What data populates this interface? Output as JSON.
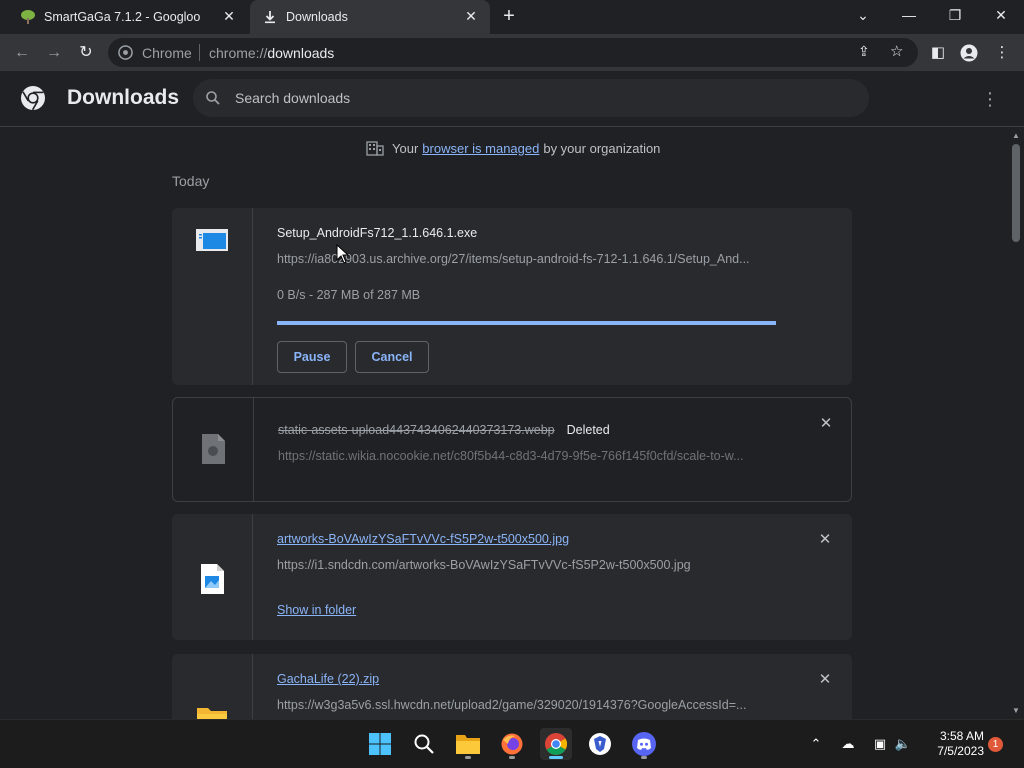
{
  "browser": {
    "tabs": [
      {
        "title": "SmartGaGa 7.1.2 - Googloo",
        "active": false
      },
      {
        "title": "Downloads",
        "active": true
      }
    ],
    "omnibox": {
      "site_label": "Chrome",
      "url_scheme": "chrome://",
      "url_path": "downloads"
    }
  },
  "header": {
    "title": "Downloads",
    "search_placeholder": "Search downloads"
  },
  "managed": {
    "prefix": "Your",
    "link": "browser is managed",
    "suffix": "by your organization"
  },
  "section_label": "Today",
  "downloads": [
    {
      "filename": "Setup_AndroidFs712_1.1.646.1.exe",
      "url": "https://ia802903.us.archive.org/27/items/setup-android-fs-712-1.1.646.1/Setup_And...",
      "progress_text": "0 B/s - 287 MB of 287 MB",
      "progress": 1.0,
      "buttons": {
        "pause": "Pause",
        "cancel": "Cancel"
      }
    },
    {
      "filename": "static-assets-upload4437434062440373173.webp",
      "status": "Deleted",
      "url": "https://static.wikia.nocookie.net/c80f5b44-c8d3-4d79-9f5e-766f145f0cfd/scale-to-w..."
    },
    {
      "filename": "artworks-BoVAwIzYSaFTvVVc-fS5P2w-t500x500.jpg",
      "url": "https://i1.sndcdn.com/artworks-BoVAwIzYSaFTvVVc-fS5P2w-t500x500.jpg",
      "action": "Show in folder"
    },
    {
      "filename": "GachaLife (22).zip",
      "url": "https://w3g3a5v6.ssl.hwcdn.net/upload2/game/329020/1914376?GoogleAccessId=..."
    }
  ],
  "taskbar": {
    "time": "3:58 AM",
    "date": "7/5/2023",
    "notification_count": "1"
  },
  "colors": {
    "accent": "#8ab4f8",
    "background": "#202124",
    "card": "#292a2d",
    "taskbar_active": "#60cdff"
  },
  "icons": [
    "chrome-logo-icon",
    "search-icon",
    "building-icon",
    "exe-file-icon",
    "image-file-icon",
    "folder-icon",
    "windows-start-icon"
  ]
}
